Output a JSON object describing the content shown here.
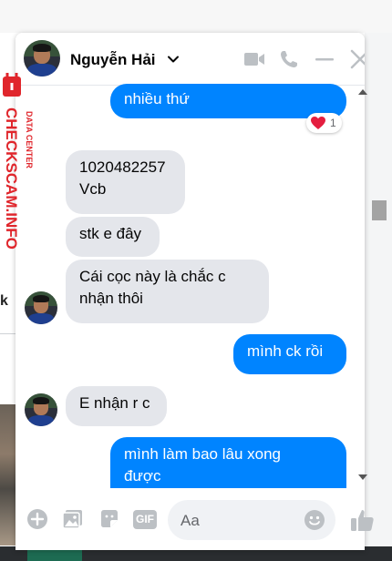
{
  "header": {
    "contact_name": "Nguyễn Hải"
  },
  "messages": [
    {
      "side": "outgoing",
      "lines": [
        "nhiều thứ"
      ]
    },
    {
      "side": "incoming",
      "lines": [
        "1020482257",
        "Vcb"
      ]
    },
    {
      "side": "incoming",
      "lines": [
        "stk e đây"
      ]
    },
    {
      "side": "incoming",
      "lines": [
        "Cái cọc này là chắc c",
        "nhận thôi"
      ]
    },
    {
      "side": "outgoing",
      "lines": [
        "mình ck rồi"
      ]
    },
    {
      "side": "incoming",
      "lines": [
        "E nhận r c"
      ]
    },
    {
      "side": "outgoing",
      "lines": [
        "mình làm bao lâu xong",
        "được"
      ]
    }
  ],
  "reaction": {
    "emoji": "heart",
    "count": "1"
  },
  "composer": {
    "placeholder": "Aa",
    "gif_label": "GIF"
  },
  "watermark": {
    "brand": "CHECKSCAM.INFO",
    "sub": "DATA CENTER"
  },
  "background": {
    "fragment_text": "k"
  },
  "colors": {
    "accent": "#0084ff",
    "incoming_bubble": "#e4e6eb",
    "icon_gray": "#bcc0c4",
    "watermark_red": "#e0262c"
  }
}
